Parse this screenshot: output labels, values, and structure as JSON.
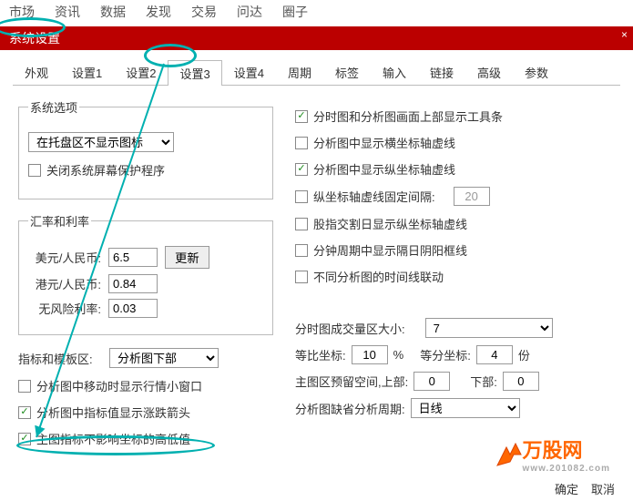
{
  "topnav": [
    "市场",
    "资讯",
    "数据",
    "发现",
    "交易",
    "问达",
    "圈子"
  ],
  "titlebar": {
    "title": "系统设置",
    "close": "×"
  },
  "tabs": [
    "外观",
    "设置1",
    "设置2",
    "设置3",
    "设置4",
    "周期",
    "标签",
    "输入",
    "链接",
    "高级",
    "参数"
  ],
  "active_tab": 3,
  "sys_options": {
    "legend": "系统选项",
    "tray_select": "在托盘区不显示图标",
    "close_screensaver": "关闭系统屏幕保护程序"
  },
  "rates": {
    "legend": "汇率和利率",
    "usd_label": "美元/人民币:",
    "usd_value": "6.5",
    "update_btn": "更新",
    "hkd_label": "港元/人民币:",
    "hkd_value": "0.84",
    "riskfree_label": "无风险利率:",
    "riskfree_value": "0.03"
  },
  "left_bottom": {
    "indicator_template_label": "指标和模板区:",
    "indicator_template_select": "分析图下部",
    "cb_move_quote": "分析图中移动时显示行情小窗口",
    "cb_arrow": "分析图中指标值显示涨跌箭头",
    "cb_main_indicator": "主图指标不影响坐标的高低值"
  },
  "right_checks": {
    "cb_toolbar": "分时图和分析图画面上部显示工具条",
    "cb_hline": "分析图中显示横坐标轴虚线",
    "cb_vline": "分析图中显示纵坐标轴虚线",
    "cb_fix_interval": "纵坐标轴虚线固定间隔:",
    "fix_interval_value": "20",
    "cb_index_delivery": "股指交割日显示纵坐标轴虚线",
    "cb_minute_yinyang": "分钟周期中显示隔日阴阳框线",
    "cb_time_link": "不同分析图的时间线联动"
  },
  "right_bottom": {
    "vol_area_label": "分时图成交量区大小:",
    "vol_area_value": "7",
    "eq_ratio_label": "等比坐标:",
    "eq_ratio_value": "10",
    "eq_ratio_pct": "%",
    "eq_div_label": "等分坐标:",
    "eq_div_value": "4",
    "eq_div_unit": "份",
    "reserve_label": "主图区预留空间,上部:",
    "reserve_top": "0",
    "reserve_bot_label": "下部:",
    "reserve_bot": "0",
    "default_period_label": "分析图缺省分析周期:",
    "default_period_value": "日线"
  },
  "footer": {
    "ok": "确定",
    "cancel": "取消"
  },
  "watermark": {
    "brand": "万股网",
    "url": "www.201082.com"
  }
}
